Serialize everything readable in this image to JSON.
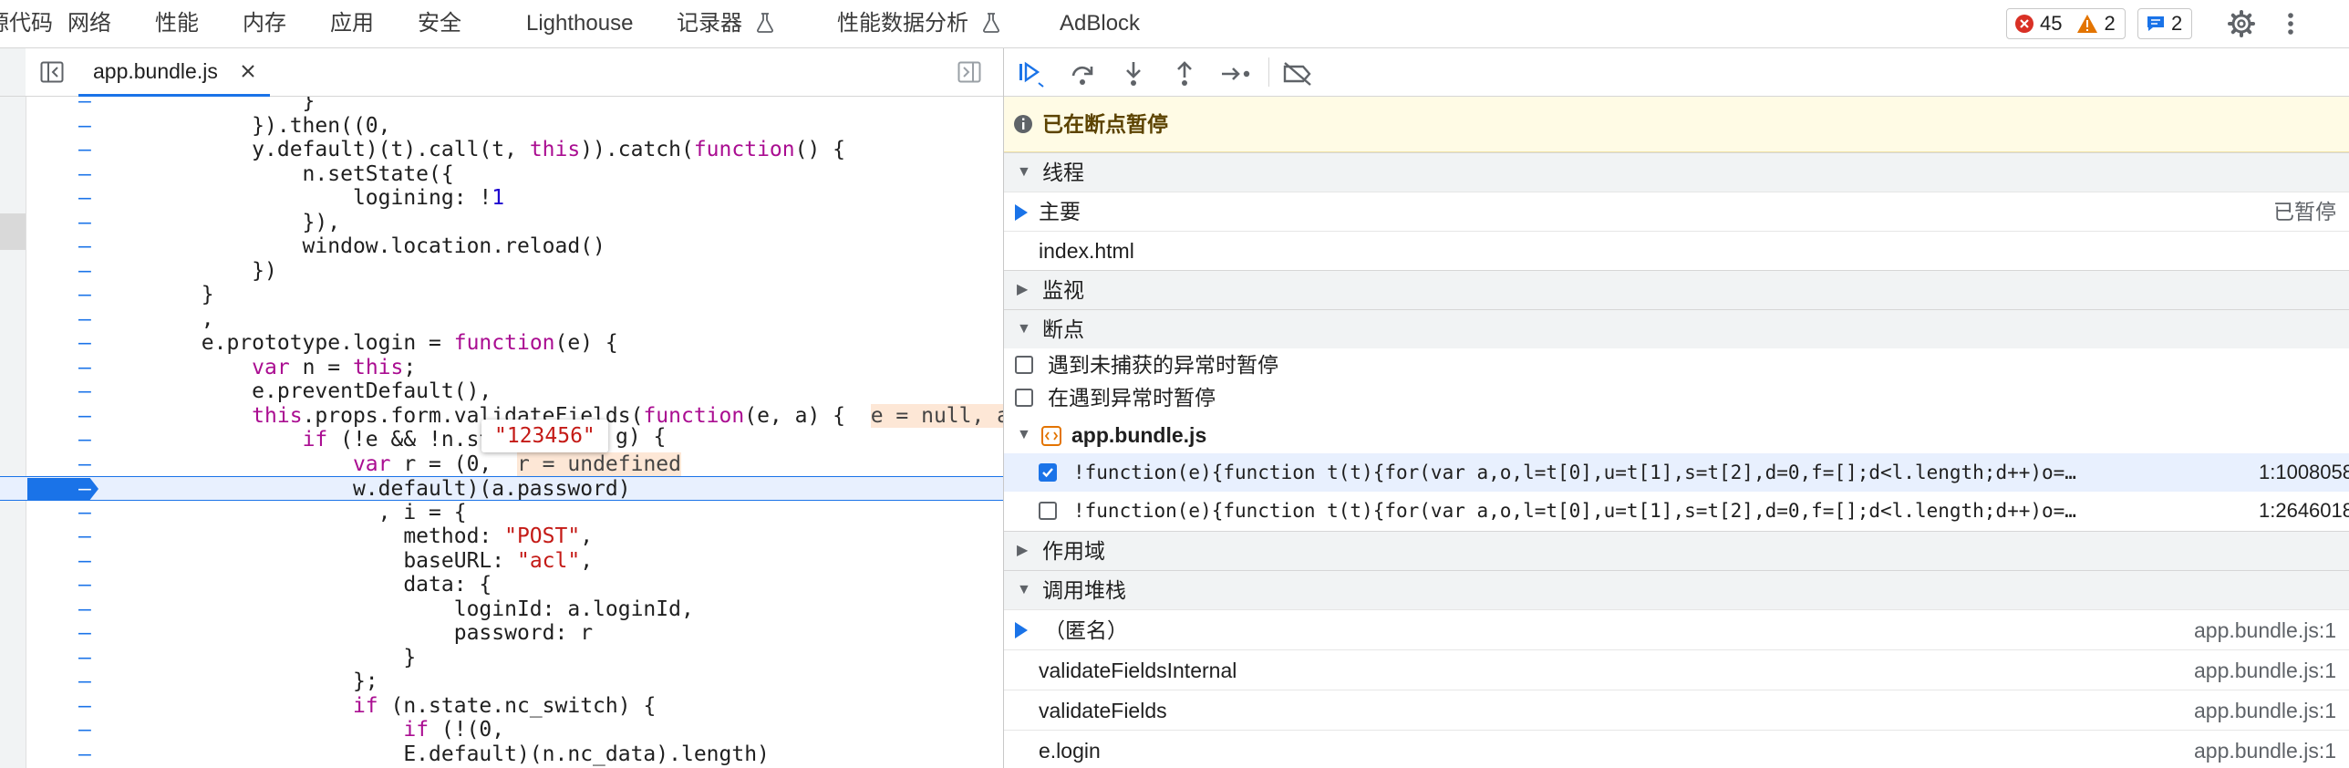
{
  "top_tabs": [
    {
      "label": "源代码"
    },
    {
      "label": "网络"
    },
    {
      "label": "性能"
    },
    {
      "label": "内存"
    },
    {
      "label": "应用"
    },
    {
      "label": "安全"
    },
    {
      "label": "Lighthouse"
    },
    {
      "label": "记录器"
    },
    {
      "label": "性能数据分析"
    },
    {
      "label": "AdBlock"
    }
  ],
  "issues": {
    "errors": "45",
    "warnings": "2",
    "messages": "2"
  },
  "colors": {
    "error": "#d93025",
    "warning": "#e37400",
    "info": "#1a73e8",
    "accent": "#1a73e8",
    "paused_bg": "#fffbe5",
    "exec_line": "#e8f0fe"
  },
  "editor": {
    "file_tab": "app.bundle.js",
    "tooltip": "\"123456\"",
    "lines": [
      [
        {
          "t": "                }"
        }
      ],
      [
        {
          "t": "            }).then((0,"
        }
      ],
      [
        {
          "t": "            y.default)(t).call(t, "
        },
        {
          "t": "this",
          "c": "kw"
        },
        {
          "t": ")).catch("
        },
        {
          "t": "function",
          "c": "kw"
        },
        {
          "t": "() {"
        }
      ],
      [
        {
          "t": "                n.setState({"
        }
      ],
      [
        {
          "t": "                    logining: !"
        },
        {
          "t": "1",
          "c": "nm"
        }
      ],
      [
        {
          "t": "                }),"
        }
      ],
      [
        {
          "t": "                window.location.reload()"
        }
      ],
      [
        {
          "t": "            })"
        }
      ],
      [
        {
          "t": "        }"
        }
      ],
      [
        {
          "t": "        ,"
        }
      ],
      [
        {
          "t": "        e.prototype.login = "
        },
        {
          "t": "function",
          "c": "kw"
        },
        {
          "t": "(e) {"
        }
      ],
      [
        {
          "t": "            "
        },
        {
          "t": "var",
          "c": "kw"
        },
        {
          "t": " n = "
        },
        {
          "t": "this",
          "c": "kw"
        },
        {
          "t": ";"
        }
      ],
      [
        {
          "t": "            e.preventDefault(),"
        }
      ],
      [
        {
          "t": "            "
        },
        {
          "t": "this",
          "c": "kw"
        },
        {
          "t": ".props.form.validateFields("
        },
        {
          "t": "function",
          "c": "kw"
        },
        {
          "t": "(e, a) {  "
        },
        {
          "t": "e = null, a",
          "c": "inl"
        }
      ],
      [
        {
          "t": "                "
        },
        {
          "t": "if",
          "c": "kw"
        },
        {
          "t": " (!e && !n.sta"
        }
      ],
      [
        {
          "t": "                    "
        },
        {
          "t": "var",
          "c": "kw"
        },
        {
          "t": " r = (0,  "
        },
        {
          "t": "r = undefined",
          "c": "inl"
        }
      ],
      [
        {
          "t": "                    w.default)(a.password)"
        }
      ],
      [
        {
          "t": "                      , i = {"
        }
      ],
      [
        {
          "t": "                        method: "
        },
        {
          "t": "\"POST\"",
          "c": "st"
        },
        {
          "t": ","
        }
      ],
      [
        {
          "t": "                        baseURL: "
        },
        {
          "t": "\"acl\"",
          "c": "st"
        },
        {
          "t": ","
        }
      ],
      [
        {
          "t": "                        data: {"
        }
      ],
      [
        {
          "t": "                            loginId: a.loginId,"
        }
      ],
      [
        {
          "t": "                            password: r"
        }
      ],
      [
        {
          "t": "                        }"
        }
      ],
      [
        {
          "t": "                    };"
        }
      ],
      [
        {
          "t": "                    "
        },
        {
          "t": "if",
          "c": "kw"
        },
        {
          "t": " (n.state.nc_switch) {"
        }
      ],
      [
        {
          "t": "                        "
        },
        {
          "t": "if",
          "c": "kw"
        },
        {
          "t": " (!(0,"
        }
      ],
      [
        {
          "t": "                        E.default)(n.nc_data).length)"
        }
      ]
    ],
    "gutter_marker": "–",
    "tooltip_tail": "g) {"
  },
  "debugger": {
    "paused_label": "已在断点暂停",
    "threads": {
      "title": "线程",
      "main": "主要",
      "main_status": "已暂停",
      "frame": "index.html"
    },
    "watch": {
      "title": "监视"
    },
    "breakpoints": {
      "title": "断点",
      "uncaught": "遇到未捕获的异常时暂停",
      "caught": "在遇到异常时暂停",
      "file": "app.bundle.js",
      "items": [
        {
          "checked": true,
          "code": "!function(e){function t(t){for(var a,o,l=t[0],u=t[1],s=t[2],d=0,f=[];d<l.length;d++)o=…",
          "loc": "1:1008058"
        },
        {
          "checked": false,
          "code": "!function(e){function t(t){for(var a,o,l=t[0],u=t[1],s=t[2],d=0,f=[];d<l.length;d++)o=…",
          "loc": "1:2646018"
        }
      ]
    },
    "scope": {
      "title": "作用域"
    },
    "call_stack": {
      "title": "调用堆栈",
      "frames": [
        {
          "name": "（匿名）",
          "loc": "app.bundle.js:1",
          "current": true
        },
        {
          "name": "validateFieldsInternal",
          "loc": "app.bundle.js:1",
          "current": false
        },
        {
          "name": "validateFields",
          "loc": "app.bundle.js:1",
          "current": false
        },
        {
          "name": "e.login",
          "loc": "app.bundle.js:1",
          "current": false
        }
      ]
    }
  }
}
